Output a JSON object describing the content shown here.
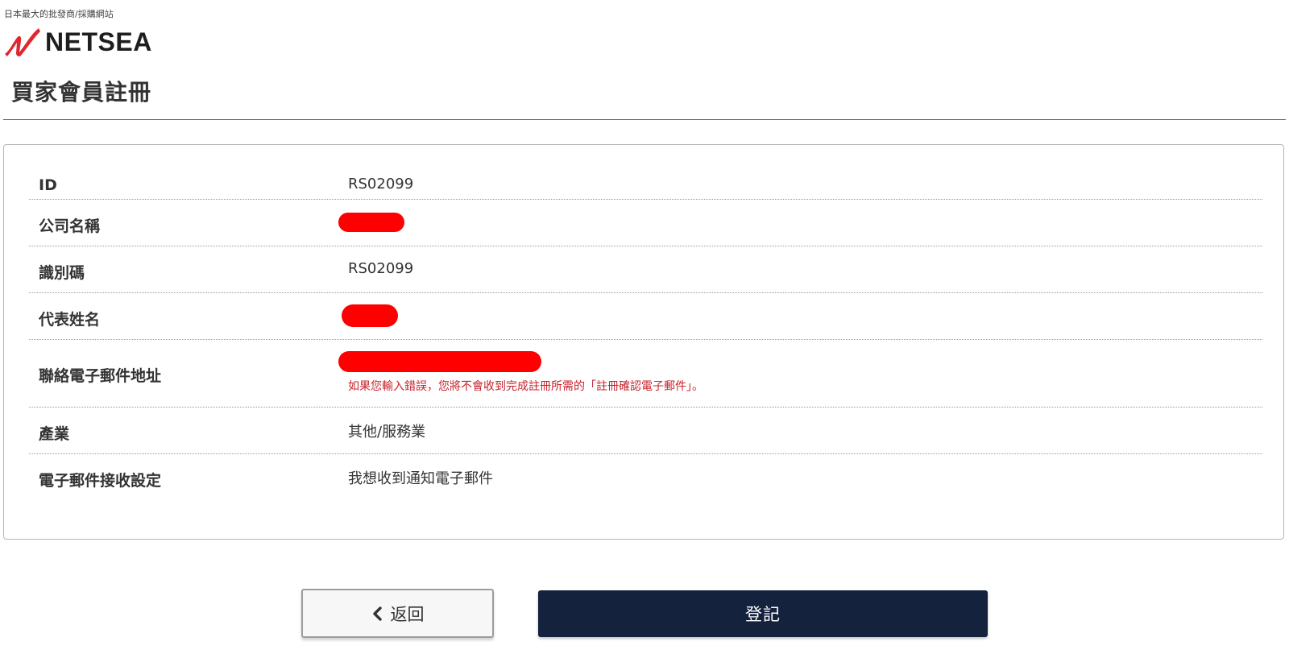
{
  "header": {
    "tagline": "日本最大的批發商/採購網站",
    "logo_text": "NETSEA",
    "logo_color": "#e3262d",
    "page_title": "買家會員註冊"
  },
  "details": {
    "rows": [
      {
        "label": "ID",
        "value": "RS02099"
      },
      {
        "label": "公司名稱",
        "value": "",
        "redacted": true
      },
      {
        "label": "識別碼",
        "value": "RS02099"
      },
      {
        "label": "代表姓名",
        "value": "",
        "redacted": true
      },
      {
        "label": "聯絡電子郵件地址",
        "value": "",
        "redacted": true,
        "note": "如果您輸入錯誤，您將不會收到完成註冊所需的「註冊確認電子郵件」。"
      },
      {
        "label": "產業",
        "value": "其他/服務業"
      },
      {
        "label": "電子郵件接收設定",
        "value": "我想收到通知電子郵件"
      }
    ]
  },
  "actions": {
    "back_label": "返回",
    "back_icon": "chevron-left-icon",
    "submit_label": "登記",
    "submit_color": "#15223d"
  }
}
